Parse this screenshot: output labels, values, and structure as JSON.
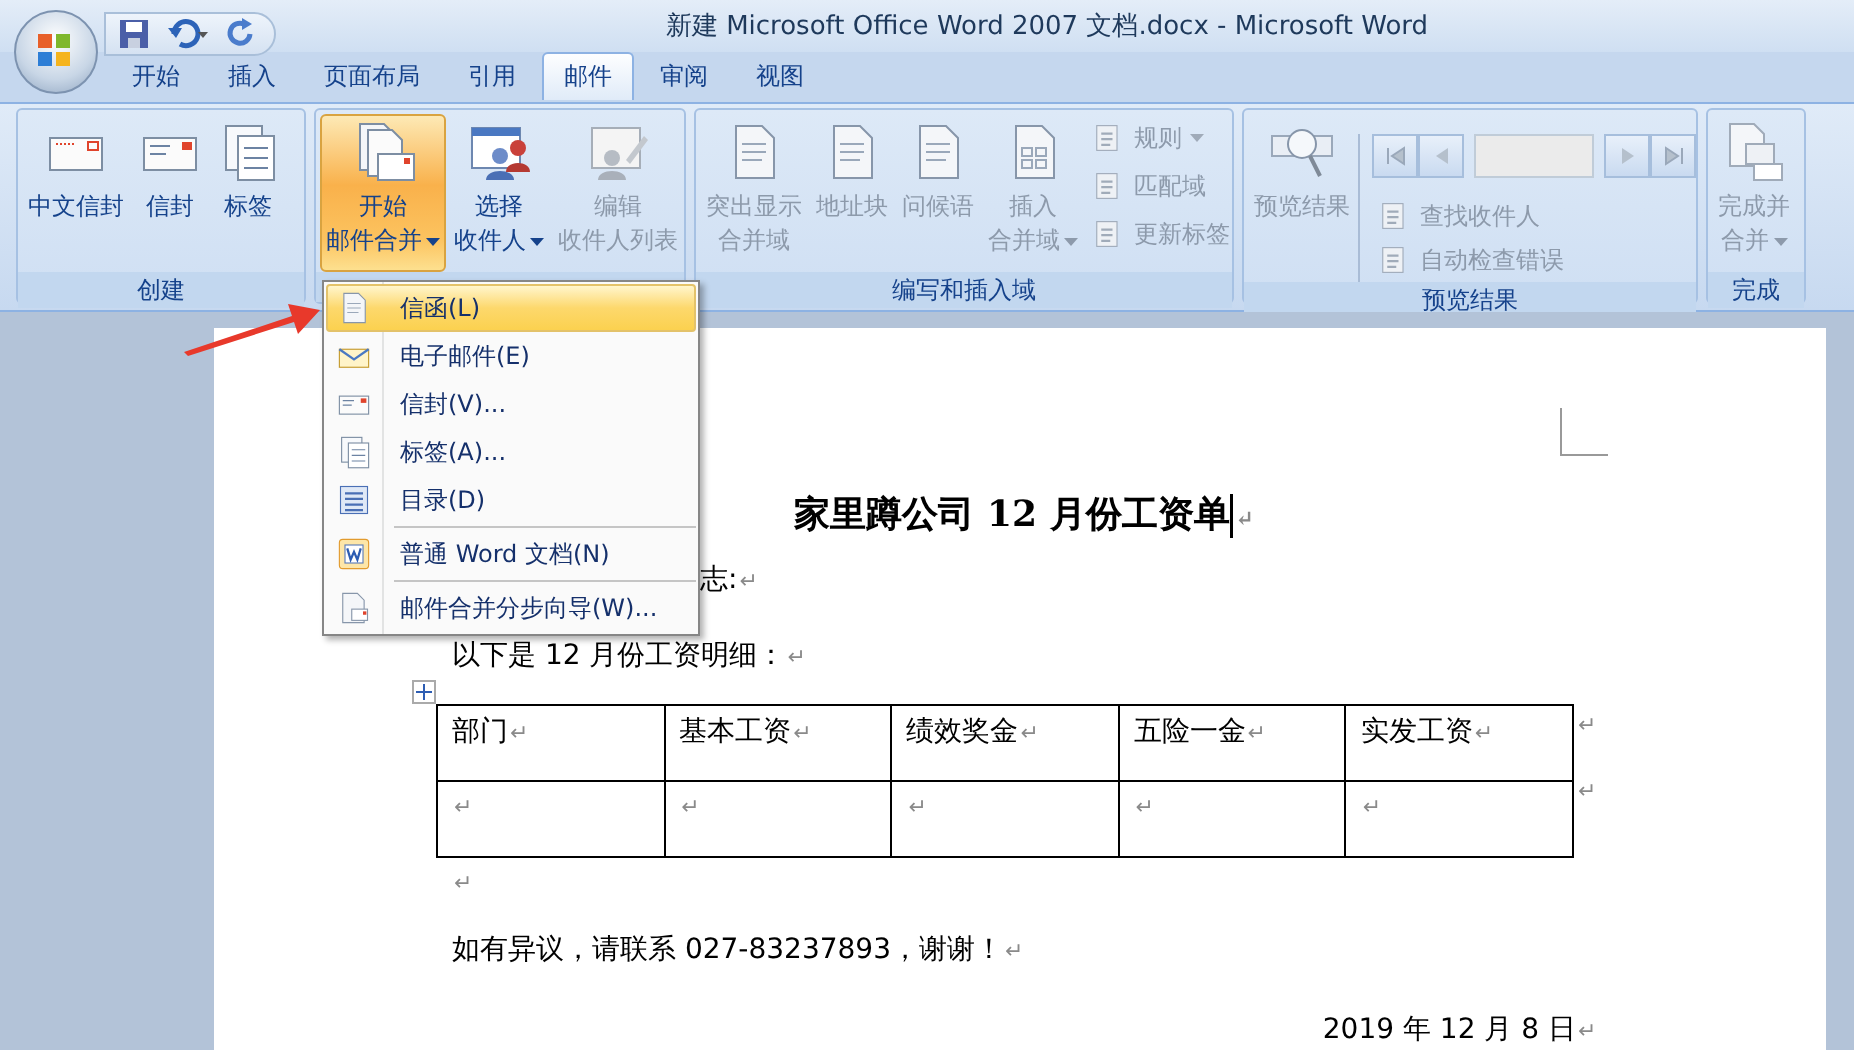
{
  "title_bar": {
    "title": "新建 Microsoft Office Word 2007 文档.docx - Microsoft Word"
  },
  "ribbon_tabs": [
    {
      "label": "开始",
      "selected": false
    },
    {
      "label": "插入",
      "selected": false
    },
    {
      "label": "页面布局",
      "selected": false
    },
    {
      "label": "引用",
      "selected": false
    },
    {
      "label": "邮件",
      "selected": true
    },
    {
      "label": "审阅",
      "selected": false
    },
    {
      "label": "视图",
      "selected": false
    }
  ],
  "ribbon_groups": [
    {
      "label": "创建",
      "items": [
        {
          "kind": "large",
          "lines": [
            "中文信封"
          ],
          "disabled": false,
          "pressed": false,
          "dropdown": false
        },
        {
          "kind": "large",
          "lines": [
            "信封"
          ],
          "disabled": false,
          "pressed": false,
          "dropdown": false
        },
        {
          "kind": "large",
          "lines": [
            "标签"
          ],
          "disabled": false,
          "pressed": false,
          "dropdown": false
        }
      ]
    },
    {
      "items": [
        {
          "kind": "large",
          "lines": [
            "开始",
            "邮件合并"
          ],
          "disabled": false,
          "pressed": true,
          "dropdown": true
        },
        {
          "kind": "large",
          "lines": [
            "选择",
            "收件人"
          ],
          "disabled": false,
          "pressed": false,
          "dropdown": true
        },
        {
          "kind": "large",
          "lines": [
            "编辑",
            "收件人列表"
          ],
          "disabled": true,
          "pressed": false,
          "dropdown": false
        }
      ]
    },
    {
      "label": "编写和插入域",
      "items": [
        {
          "kind": "large",
          "lines": [
            "突出显示",
            "合并域"
          ],
          "disabled": true,
          "pressed": false,
          "dropdown": false
        },
        {
          "kind": "large",
          "lines": [
            "地址块"
          ],
          "disabled": true,
          "pressed": false,
          "dropdown": false
        },
        {
          "kind": "large",
          "lines": [
            "问候语"
          ],
          "disabled": true,
          "pressed": false,
          "dropdown": false
        },
        {
          "kind": "large",
          "lines": [
            "插入",
            "合并域"
          ],
          "disabled": true,
          "pressed": false,
          "dropdown": true
        },
        {
          "kind": "stack",
          "items": [
            {
              "label": "规则",
              "dropdown": true
            },
            {
              "label": "匹配域",
              "dropdown": false
            },
            {
              "label": "更新标签",
              "dropdown": false
            }
          ],
          "disabled": true
        }
      ]
    },
    {
      "label": "预览结果",
      "items": [
        {
          "kind": "large",
          "lines": [
            "预览结果"
          ],
          "disabled": true,
          "pressed": false,
          "dropdown": false
        },
        {
          "kind": "nav",
          "disabled": true,
          "items": [
            {
              "label": "查找收件人"
            },
            {
              "label": "自动检查错误"
            }
          ]
        }
      ]
    },
    {
      "label": "完成",
      "items": [
        {
          "kind": "large",
          "lines": [
            "完成并",
            "合并"
          ],
          "disabled": true,
          "pressed": false,
          "dropdown": true
        }
      ]
    }
  ],
  "merge_menu": [
    {
      "label": "信函(L)",
      "selected": true,
      "separator_before": false
    },
    {
      "label": "电子邮件(E)",
      "selected": false,
      "separator_before": false
    },
    {
      "label": "信封(V)...",
      "selected": false,
      "separator_before": false
    },
    {
      "label": "标签(A)...",
      "selected": false,
      "separator_before": false
    },
    {
      "label": "目录(D)",
      "selected": false,
      "separator_before": false
    },
    {
      "label": "普通 Word 文档(N)",
      "selected": false,
      "separator_before": true
    },
    {
      "label": "邮件合并分步向导(W)...",
      "selected": false,
      "separator_before": true
    }
  ],
  "document": {
    "title": "家里蹲公司 12 月份工资单",
    "title_mark": "↵",
    "greeting": {
      "text": "志:",
      "mark": "↵"
    },
    "intro": {
      "text": "以下是 12 月份工资明细：",
      "mark": "↵"
    },
    "table": {
      "header": [
        {
          "text": "部门",
          "mark": "↵"
        },
        {
          "text": "基本工资",
          "mark": "↵"
        },
        {
          "text": "绩效奖金",
          "mark": "↵"
        },
        {
          "text": "五险一金",
          "mark": "↵"
        },
        {
          "text": "实发工资",
          "mark": "↵"
        }
      ],
      "rows": [
        [
          {
            "mark": "↵"
          },
          {
            "mark": "↵"
          },
          {
            "mark": "↵"
          },
          {
            "mark": "↵"
          },
          {
            "mark": "↵"
          }
        ]
      ],
      "row_end_marks": [
        "↵",
        "↵"
      ]
    },
    "after_table": {
      "mark": "↵"
    },
    "contact": {
      "text": "如有异议，请联系 027-83237893，谢谢！",
      "mark": "↵"
    },
    "date": {
      "text": "2019 年 12 月 8 日",
      "mark": "↵"
    }
  }
}
